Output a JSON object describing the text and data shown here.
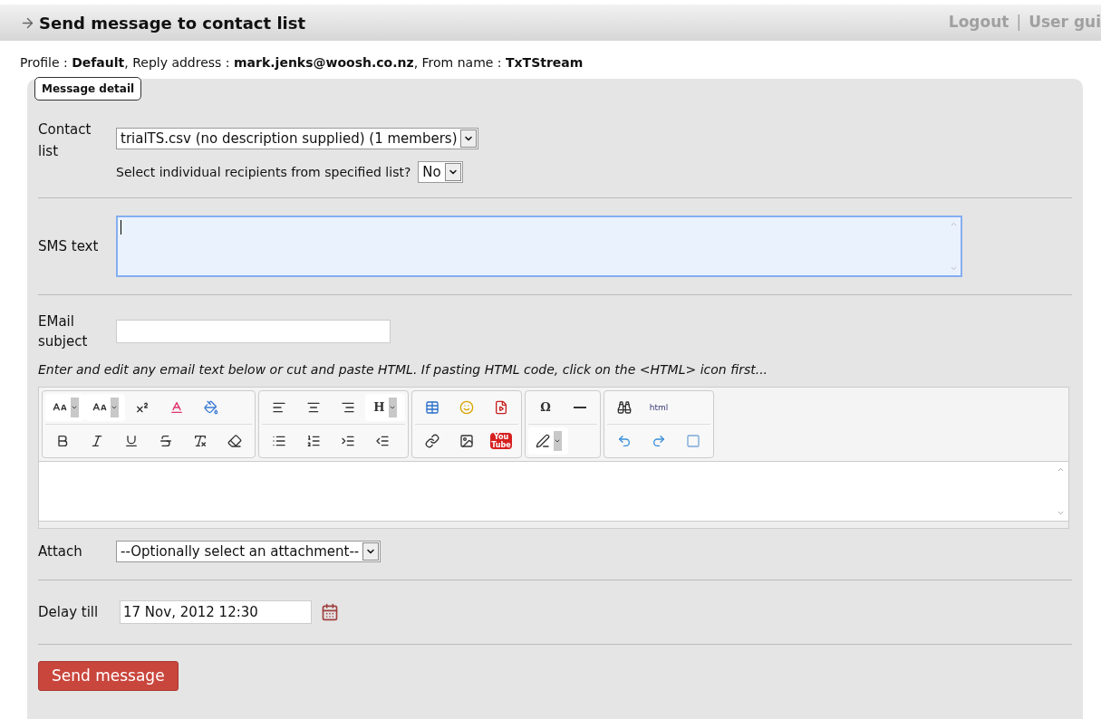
{
  "header": {
    "title": "Send message to contact list",
    "links": [
      "Logout",
      "User gui"
    ],
    "separator": "|"
  },
  "profile": {
    "text": "Profile : **Default**, Reply address : **mark.jenks@woosh.co.nz**, From name : **TxTStream**"
  },
  "panel": {
    "legend": "Message detail",
    "contact_list": {
      "label": "Contact list",
      "value": "trialTS.csv (no description supplied) (1 members)",
      "individual_label": "Select individual recipients from specified list?",
      "individual_value": "No"
    },
    "sms": {
      "label": "SMS text"
    },
    "email": {
      "label": "EMail subject",
      "hint": "Enter and edit any email text below or cut and paste HTML. If pasting HTML code, click on the <HTML> icon first..."
    },
    "toolbar_labels": [
      "H",
      "You Tube",
      "Ω",
      "html"
    ],
    "attach": {
      "label": "Attach",
      "value": "--Optionally select an attachment--"
    },
    "delay": {
      "label": "Delay till",
      "value": "17 Nov, 2012 12:30"
    },
    "send_button": "Send message"
  }
}
